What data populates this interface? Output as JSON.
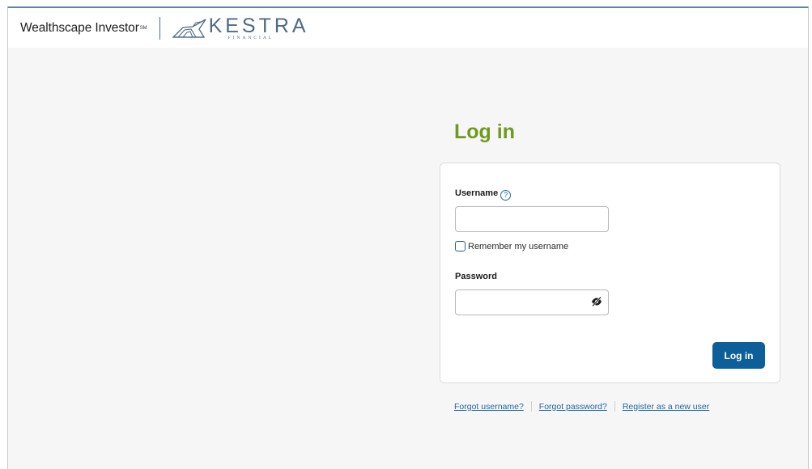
{
  "header": {
    "brand": "Wealthscape Investor",
    "brand_mark": "SM",
    "partner_logo": {
      "word": "KESTRA",
      "sub": "FINANCIAL",
      "icon": "kestra-logo-mark"
    }
  },
  "login": {
    "title": "Log in",
    "username_label": "Username",
    "help_icon": "?",
    "username_value": "",
    "remember_label": "Remember my username",
    "remember_checked": false,
    "password_label": "Password",
    "password_value": "",
    "toggle_icon": "eye-slash-icon",
    "submit_label": "Log in"
  },
  "links": {
    "forgot_username": "Forgot username?",
    "forgot_password": "Forgot password?",
    "register": "Register as a new user"
  },
  "colors": {
    "title": "#6f9a1f",
    "button": "#0d5f99",
    "link": "#1f66a0",
    "background": "#f6f6f6"
  }
}
